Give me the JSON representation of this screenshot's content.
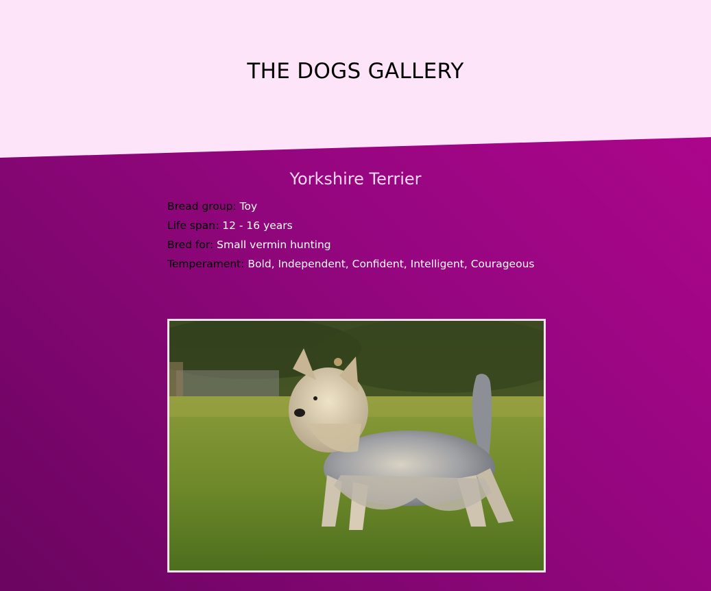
{
  "page": {
    "title": "THE DOGS GALLERY"
  },
  "breed": {
    "name": "Yorkshire Terrier",
    "facts": [
      {
        "label": "Bread group:",
        "value": "Toy"
      },
      {
        "label": "Life span:",
        "value": "12 - 16 years"
      },
      {
        "label": "Bred for:",
        "value": "Small vermin hunting"
      },
      {
        "label": "Temperament:",
        "value": "Bold, Independent, Confident, Intelligent, Courageous"
      }
    ]
  },
  "colors": {
    "header_bg": "#fde4f8",
    "gradient_light": "#b2058f",
    "gradient_dark": "#6a0560",
    "breed_title": "#ffd9f6",
    "value_text": "#ffffff",
    "label_text": "#000000",
    "frame_border": "#f3e3ee"
  }
}
